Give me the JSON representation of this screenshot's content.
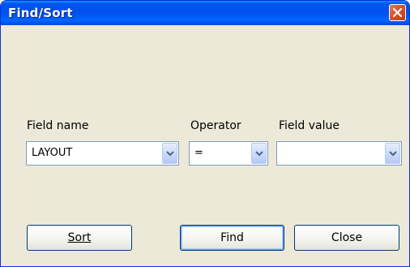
{
  "window": {
    "title": "Find/Sort"
  },
  "icons": {
    "close": "close-icon",
    "dropdown": "chevron-down-icon"
  },
  "colors": {
    "titlebar": "#0053ee",
    "close_button": "#d84e28",
    "dialog_bg": "#ece9d8",
    "field_border": "#7f9db9"
  },
  "form": {
    "field_name": {
      "label": "Field name",
      "value": "LAYOUT"
    },
    "operator": {
      "label": "Operator",
      "value": "="
    },
    "field_value": {
      "label": "Field value",
      "value": ""
    }
  },
  "buttons": {
    "sort_label": "Sort",
    "find_label": "Find",
    "close_label": "Close"
  }
}
